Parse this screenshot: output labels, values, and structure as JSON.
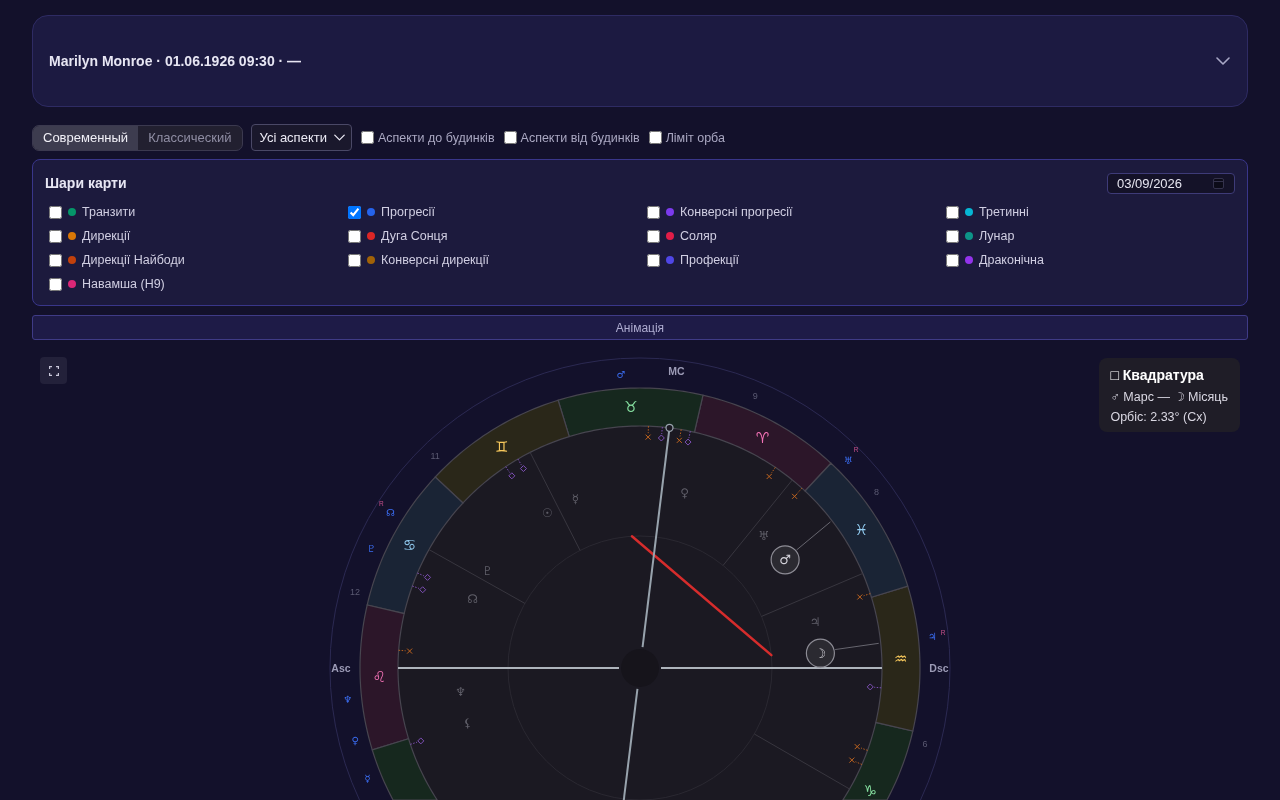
{
  "header": {
    "title": "Marilyn Monroe · 01.06.1926 09:30 · —",
    "expanded": false
  },
  "controls": {
    "modes": [
      {
        "label": "Современный",
        "selected": true
      },
      {
        "label": "Классический",
        "selected": false
      }
    ],
    "aspect_filter": {
      "value": "Усі аспекти"
    },
    "options": [
      {
        "label": "Аспекти до будинків",
        "checked": false
      },
      {
        "label": "Аспекти від будинків",
        "checked": false
      },
      {
        "label": "Ліміт орба",
        "checked": false
      }
    ]
  },
  "layers": {
    "title": "Шари карти",
    "date": "03/09/2026",
    "items": [
      {
        "label": "Транзити",
        "color": "#059669",
        "checked": false
      },
      {
        "label": "Прогресії",
        "color": "#2563eb",
        "checked": true
      },
      {
        "label": "Конверсні прогресії",
        "color": "#7c3aed",
        "checked": false
      },
      {
        "label": "Третинні",
        "color": "#06b6d4",
        "checked": false
      },
      {
        "label": "Дирекції",
        "color": "#d97706",
        "checked": false
      },
      {
        "label": "Дуга Сонця",
        "color": "#dc2626",
        "checked": false
      },
      {
        "label": "Соляр",
        "color": "#e11d48",
        "checked": false
      },
      {
        "label": "Лунар",
        "color": "#0d9488",
        "checked": false
      },
      {
        "label": "Дирекції Найбоди",
        "color": "#c2410c",
        "checked": false
      },
      {
        "label": "Конверсні дирекції",
        "color": "#a16207",
        "checked": false
      },
      {
        "label": "Профекції",
        "color": "#4f46e5",
        "checked": false
      },
      {
        "label": "Драконічна",
        "color": "#9333ea",
        "checked": false
      },
      {
        "label": "Навамша (H9)",
        "color": "#db2777",
        "checked": false
      }
    ]
  },
  "animation": {
    "label": "Анімація"
  },
  "chart": {
    "angles": [
      {
        "kind": "mc",
        "label": "MC"
      },
      {
        "kind": "asc",
        "label": "Asc"
      },
      {
        "kind": "dsc",
        "label": "Dsc"
      }
    ],
    "signs": [
      {
        "kind": "aries",
        "glyph": "♈"
      },
      {
        "kind": "taurus",
        "glyph": "♉"
      },
      {
        "kind": "gemini",
        "glyph": "♊"
      },
      {
        "kind": "cancer",
        "glyph": "♋"
      },
      {
        "kind": "leo",
        "glyph": "♌"
      },
      {
        "kind": "virgo"
      },
      {
        "kind": "capricorn",
        "glyph": "♑"
      },
      {
        "kind": "aquarius",
        "glyph": "♒"
      },
      {
        "kind": "pisces",
        "glyph": "♓"
      }
    ],
    "house_numbers": [
      {
        "kind": "house_9",
        "label": "9"
      },
      {
        "kind": "house_11",
        "label": "11"
      },
      {
        "kind": "house_8",
        "label": "8"
      },
      {
        "kind": "house_12",
        "label": "12"
      },
      {
        "kind": "house_6",
        "label": "6"
      }
    ],
    "outer_planets": [
      {
        "kind": "mars",
        "glyph": "♂"
      },
      {
        "kind": "uranus",
        "glyph": "♅",
        "retrograde_mark": "R"
      },
      {
        "kind": "node",
        "glyph": "☊",
        "retrograde_mark": "R"
      },
      {
        "kind": "pluto",
        "glyph": "♇"
      },
      {
        "kind": "jupiter",
        "glyph": "♃",
        "retrograde_mark": "R"
      },
      {
        "kind": "neptune",
        "glyph": "♆"
      },
      {
        "kind": "venus",
        "glyph": "♀"
      },
      {
        "kind": "mercury",
        "glyph": "☿"
      }
    ],
    "inner_planets": [
      {
        "kind": "venus",
        "glyph": "♀",
        "highlighted": false
      },
      {
        "kind": "mercury",
        "glyph": "☿",
        "highlighted": false
      },
      {
        "kind": "sun",
        "glyph": "☉",
        "highlighted": false
      },
      {
        "kind": "uranus",
        "glyph": "♅",
        "highlighted": false
      },
      {
        "kind": "mars",
        "glyph": "♂",
        "highlighted": true
      },
      {
        "kind": "pluto",
        "glyph": "♇",
        "highlighted": false
      },
      {
        "kind": "node",
        "glyph": "☊",
        "highlighted": false
      },
      {
        "kind": "jupiter",
        "glyph": "♃",
        "highlighted": false
      },
      {
        "kind": "moon",
        "glyph": "☽",
        "highlighted": true
      },
      {
        "kind": "neptune",
        "glyph": "♆",
        "highlighted": false
      },
      {
        "kind": "lilith",
        "glyph": "⚸",
        "highlighted": false
      }
    ],
    "aspects": [
      {
        "kind": "square"
      }
    ]
  },
  "tooltip": {
    "title": "□ Квадратура",
    "planets": "♂ Марс — ☽ Місяць",
    "orb": "Орбіс: 2.33° (Сх)"
  }
}
